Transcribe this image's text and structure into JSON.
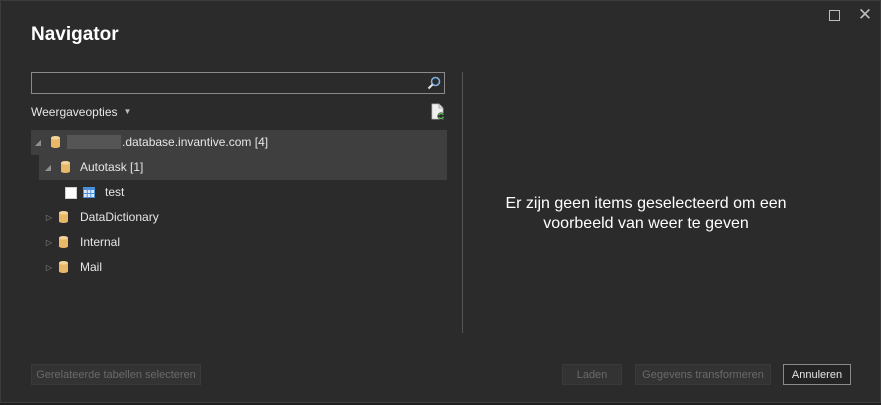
{
  "window": {
    "title": "Navigator",
    "maximize_label": "",
    "close_label": "✕"
  },
  "search": {
    "value": "",
    "placeholder": ""
  },
  "display_options": {
    "label": "Weergaveopties",
    "caret": "▼"
  },
  "tree": {
    "root": {
      "label": ".database.invantive.com [4]",
      "expanded": true,
      "selected": true
    },
    "children": [
      {
        "label": "Autotask [1]",
        "expanded": true,
        "selected": true,
        "items": [
          {
            "label": "test",
            "checked": false
          }
        ]
      },
      {
        "label": "DataDictionary",
        "expanded": false
      },
      {
        "label": "Internal",
        "expanded": false
      },
      {
        "label": "Mail",
        "expanded": false
      }
    ]
  },
  "preview": {
    "empty_message": "Er zijn geen items geselecteerd om een voorbeeld van weer te geven"
  },
  "buttons": {
    "select_related": "Gerelateerde tabellen selecteren",
    "load": "Laden",
    "transform": "Gegevens transformeren",
    "cancel": "Annuleren"
  },
  "colors": {
    "background": "#2b2b2b",
    "selection": "#3f3f3f",
    "database_icon": "#e8b867",
    "table_icon": "#4a90d9"
  },
  "icons": {
    "search": "search-icon",
    "refresh": "refresh-document-icon",
    "database": "database-icon",
    "table": "table-icon"
  }
}
